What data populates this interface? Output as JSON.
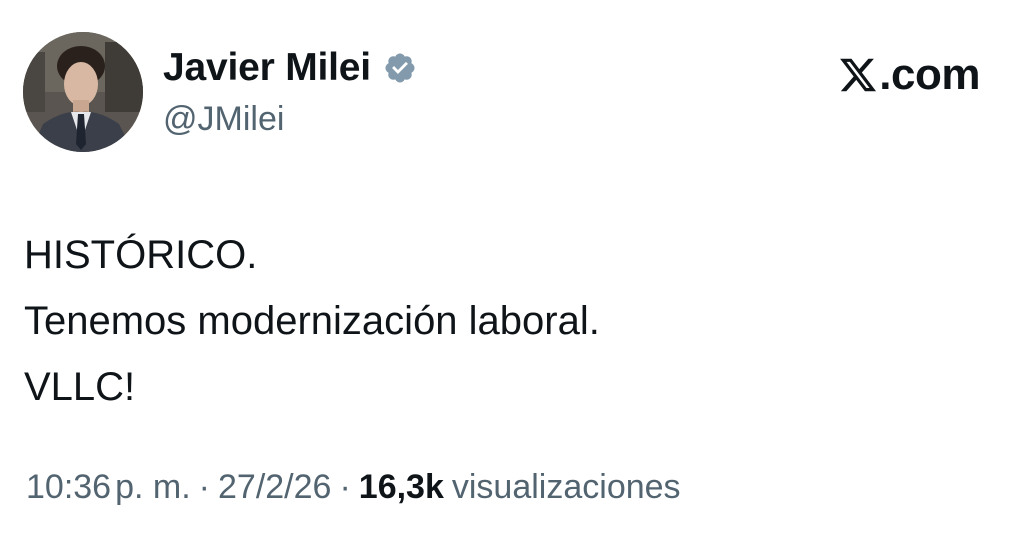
{
  "author": {
    "display_name": "Javier Milei",
    "handle": "@JMilei",
    "verified": true,
    "verified_badge_color": "#829aab",
    "avatar": "profile-photo"
  },
  "brand": {
    "logo_icon": "x-logo-icon",
    "text": ".com"
  },
  "tweet": {
    "lines": [
      "HISTÓRICO.",
      "Tenemos modernización laboral.",
      "VLLC!"
    ]
  },
  "meta": {
    "time": "10:36",
    "ampm": "p. m.",
    "separator": "·",
    "date": "27/2/26",
    "views_count": "16,3k",
    "views_label": "visualizaciones"
  },
  "colors": {
    "primary_text": "#0f1419",
    "secondary_text": "#536471",
    "background": "#ffffff"
  }
}
